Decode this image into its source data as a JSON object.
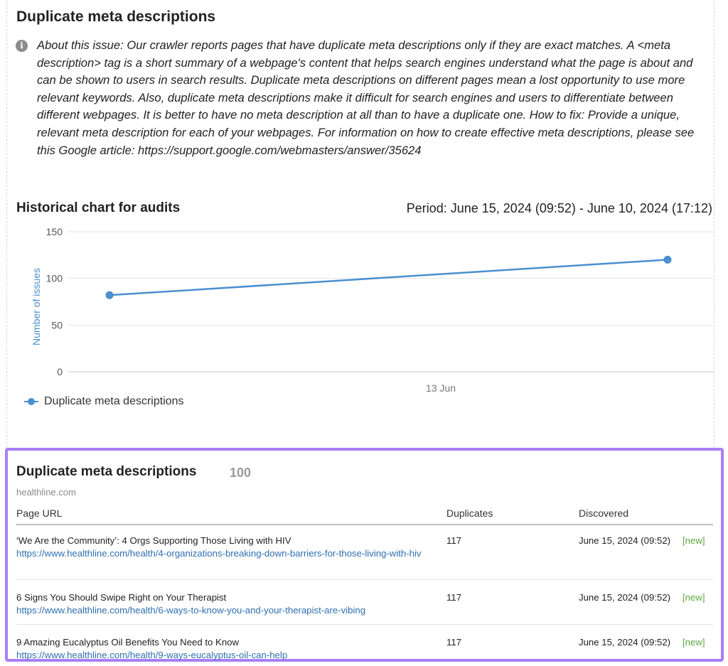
{
  "issue": {
    "title": "Duplicate meta descriptions",
    "about": "About this issue: Our crawler reports pages that have duplicate meta descriptions only if they are exact matches. A <meta description> tag is a short summary of a webpage's content that helps search engines understand what the page is about and can be shown to users in search results. Duplicate meta descriptions on different pages mean a lost opportunity to use more relevant keywords. Also, duplicate meta descriptions make it difficult for search engines and users to differentiate between different webpages. It is better to have no meta description at all than to have a duplicate one. How to fix: Provide a unique, relevant meta description for each of your webpages. For information on how to create effective meta descriptions, please see this Google article: https://support.google.com/webmasters/answer/35624",
    "info_icon": "info-icon"
  },
  "history": {
    "title": "Historical chart for audits",
    "period": "Period: June 15, 2024 (09:52) - June 10, 2024 (17:12)"
  },
  "chart_data": {
    "type": "line",
    "ylabel": "Number of issues",
    "ylim": [
      0,
      150
    ],
    "yticks": [
      "0",
      "50",
      "100",
      "150"
    ],
    "xtick_label": "13 Jun",
    "grid": true,
    "legend_position": "bottom-left",
    "series": [
      {
        "name": "Duplicate meta descriptions",
        "color": "#4a8fcf",
        "values": [
          82,
          120
        ]
      }
    ]
  },
  "table": {
    "title": "Duplicate meta descriptions",
    "count": "100",
    "domain": "healthline.com",
    "headers": {
      "url": "Page URL",
      "duplicates": "Duplicates",
      "discovered": "Discovered"
    },
    "rows": [
      {
        "title": "‘We Are the Community’: 4 Orgs Supporting Those Living with HIV",
        "url": "https://www.healthline.com/health/4-organizations-breaking-down-barriers-for-those-living-with-hiv",
        "duplicates": "117",
        "discovered": "June 15, 2024 (09:52)",
        "tag": "[new]"
      },
      {
        "title": "6 Signs You Should Swipe Right on Your Therapist",
        "url": "https://www.healthline.com/health/6-ways-to-know-you-and-your-therapist-are-vibing",
        "duplicates": "117",
        "discovered": "June 15, 2024 (09:52)",
        "tag": "[new]"
      },
      {
        "title": "9 Amazing Eucalyptus Oil Benefits You Need to Know",
        "url": "https://www.healthline.com/health/9-ways-eucalyptus-oil-can-help",
        "duplicates": "117",
        "discovered": "June 15, 2024 (09:52)",
        "tag": "[new]"
      }
    ]
  },
  "colors": {
    "accent_border": "#a97ff5",
    "link": "#2f6fb0",
    "new_tag": "#5aa83c",
    "series": "#4a8fcf"
  }
}
